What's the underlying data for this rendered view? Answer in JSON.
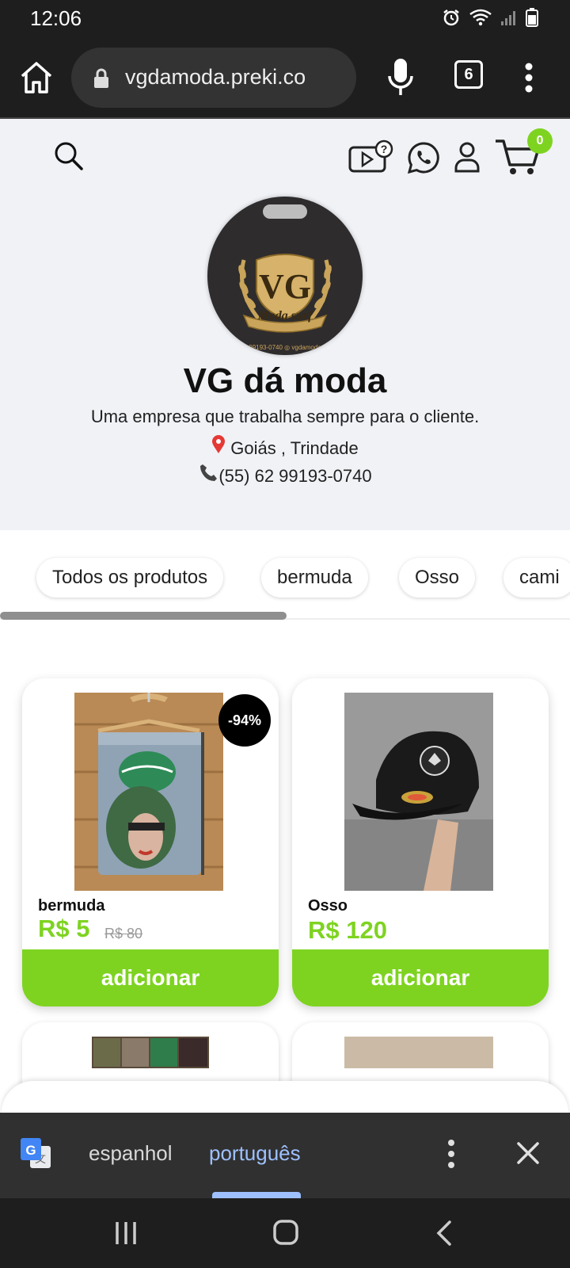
{
  "status_bar": {
    "time": "12:06"
  },
  "browser": {
    "url": "vgdamoda.preki.co",
    "tab_count": "6"
  },
  "header": {
    "cart_count": "0"
  },
  "store": {
    "name": "VG dá moda",
    "tagline": "Uma empresa que trabalha sempre para o cliente.",
    "location": "Goiás , Trindade",
    "phone": "(55) 62 99193-0740",
    "logo_text_vg": "VG",
    "logo_text_banner": "Moda surf",
    "logo_small_text": "99193-0740 ◎ vgdamoda"
  },
  "categories": [
    "Todos os produtos",
    "bermuda",
    "Osso",
    "cami"
  ],
  "products": [
    {
      "title": "bermuda",
      "price": "R$ 5",
      "old_price": "R$ 80",
      "discount": "-94%",
      "button": "adicionar"
    },
    {
      "title": "Osso",
      "price": "R$ 120",
      "button": "adicionar"
    }
  ],
  "translate": {
    "from": "espanhol",
    "to": "português"
  },
  "colors": {
    "accent": "#7ed321",
    "header_bg": "#f0f2f6",
    "chrome_bg": "#1e1e1e",
    "translate_active": "#9ec0ff"
  }
}
